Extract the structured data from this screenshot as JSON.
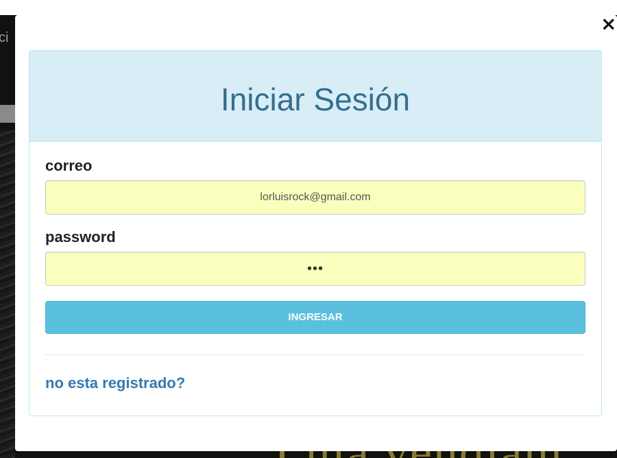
{
  "backdrop": {
    "left_letters": "ci",
    "bottom_text": "Lula vendiam"
  },
  "modal": {
    "close_glyph": "×",
    "close_icon": "close-icon",
    "title": "Iniciar Sesión",
    "fields": {
      "email": {
        "label": "correo",
        "value": "lorluisrock@gmail.com"
      },
      "password": {
        "label": "password",
        "value": "•••"
      }
    },
    "submit_label": "INGRESAR",
    "register_link": "no esta registrado?"
  },
  "colors": {
    "heading_bg": "#d9edf7",
    "heading_text": "#31708f",
    "button_bg": "#5bc0de",
    "input_autofill_bg": "#faffbd",
    "link": "#337ab7"
  }
}
